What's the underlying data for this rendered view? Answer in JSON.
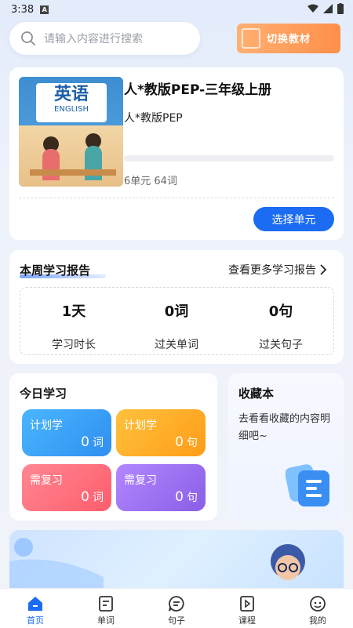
{
  "status_bar": {
    "time": "3:38",
    "badge": "A"
  },
  "search": {
    "placeholder": "请输入内容进行搜索"
  },
  "switch_button": {
    "label": "切换教材"
  },
  "book": {
    "cover_title": "英语",
    "cover_subtitle": "ENGLISH",
    "title": "人*教版PEP-三年级上册",
    "publisher": "人*教版PEP",
    "progress": 0,
    "meta": "6单元 64词",
    "select_label": "选择单元"
  },
  "report": {
    "title": "本周学习报告",
    "more": "查看更多学习报告",
    "stats": [
      {
        "value": "1天",
        "label": "学习时长"
      },
      {
        "value": "0词",
        "label": "过关单词"
      },
      {
        "value": "0句",
        "label": "过关句子"
      }
    ]
  },
  "today": {
    "title": "今日学习",
    "tiles": [
      {
        "label": "计划学",
        "value": "0",
        "unit": "词",
        "color": "#3aa2f5"
      },
      {
        "label": "计划学",
        "value": "0",
        "unit": "句",
        "color": "#ffae26"
      },
      {
        "label": "需复习",
        "value": "0",
        "unit": "词",
        "color": "#ff6f7d"
      },
      {
        "label": "需复习",
        "value": "0",
        "unit": "句",
        "color": "#9a6cf0"
      }
    ]
  },
  "favorites": {
    "title": "收藏本",
    "desc": "去看看收藏的内容明细吧~"
  },
  "tabs": [
    {
      "label": "首页",
      "icon": "home-icon",
      "active": true
    },
    {
      "label": "单词",
      "icon": "document-icon"
    },
    {
      "label": "句子",
      "icon": "chat-icon"
    },
    {
      "label": "课程",
      "icon": "play-icon"
    },
    {
      "label": "我的",
      "icon": "face-icon"
    }
  ],
  "colors": {
    "accent": "#1b6cf2",
    "switch": "#ff8f4a"
  }
}
